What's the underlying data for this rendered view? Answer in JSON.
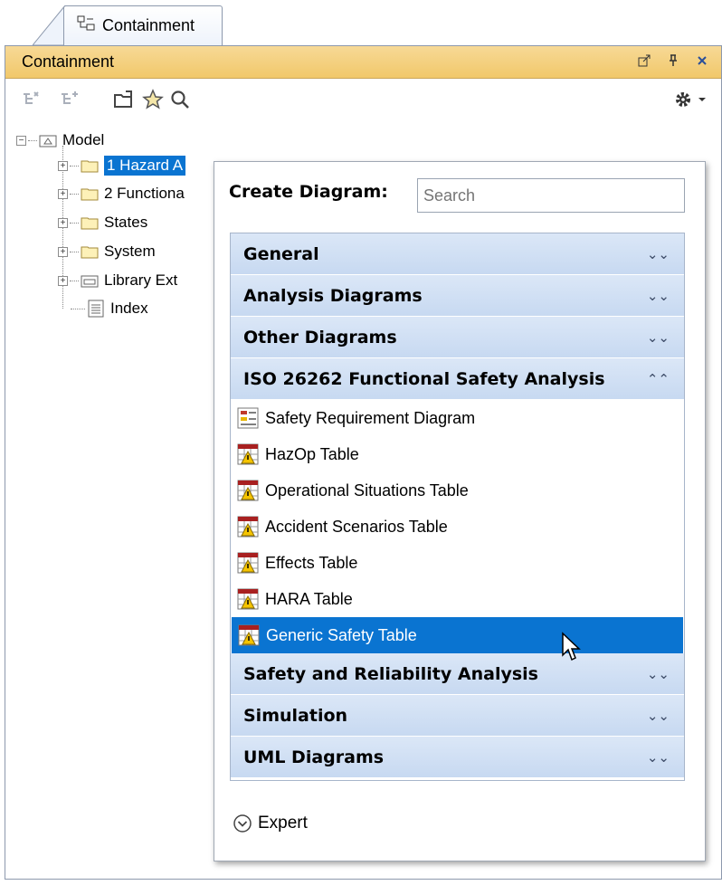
{
  "tab": {
    "label": "Containment"
  },
  "panel": {
    "title": "Containment"
  },
  "toolbar": {
    "icons": [
      "collapse-all-icon",
      "expand-all-icon",
      "open-folder-icon",
      "favorites-star-icon",
      "search-icon",
      "settings-gear-icon"
    ]
  },
  "tree": {
    "root": "Model",
    "items": [
      {
        "label": "1 Hazard A",
        "selected": true
      },
      {
        "label": "2 Functiona"
      },
      {
        "label": "States"
      },
      {
        "label": "System"
      },
      {
        "label": "Library Ext"
      },
      {
        "label": "Index"
      }
    ]
  },
  "popup": {
    "title": "Create Diagram:",
    "search_placeholder": "Search",
    "groups_top": [
      {
        "label": "General",
        "expanded": false
      },
      {
        "label": "Analysis Diagrams",
        "expanded": false
      },
      {
        "label": "Other Diagrams",
        "expanded": false
      },
      {
        "label": "ISO 26262 Functional Safety Analysis",
        "expanded": true
      }
    ],
    "items": [
      {
        "label": "Safety Requirement Diagram",
        "icon": "requirement-diagram-icon"
      },
      {
        "label": "HazOp Table",
        "icon": "safety-table-icon"
      },
      {
        "label": "Operational Situations Table",
        "icon": "safety-table-icon"
      },
      {
        "label": "Accident Scenarios Table",
        "icon": "safety-table-icon"
      },
      {
        "label": "Effects Table",
        "icon": "safety-table-icon"
      },
      {
        "label": "HARA Table",
        "icon": "safety-table-icon"
      },
      {
        "label": "Generic Safety Table",
        "icon": "safety-table-icon",
        "selected": true
      }
    ],
    "groups_bottom": [
      {
        "label": "Safety and Reliability Analysis",
        "expanded": false
      },
      {
        "label": "Simulation",
        "expanded": false
      },
      {
        "label": "UML Diagrams",
        "expanded": false
      }
    ],
    "expert_label": "Expert"
  },
  "colors": {
    "header_bg": "#f1c86a",
    "selection": "#0a74d1",
    "group_bg": "#c7d9f1"
  }
}
